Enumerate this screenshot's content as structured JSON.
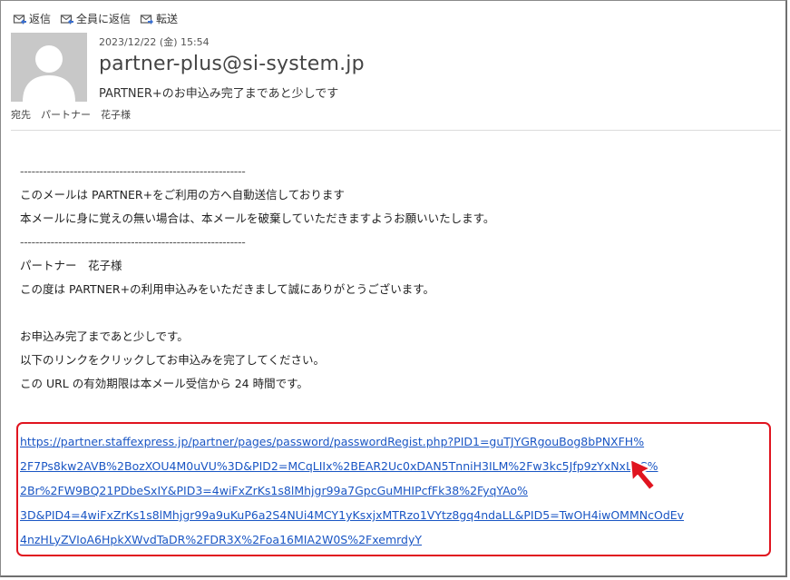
{
  "toolbar": {
    "reply": "返信",
    "reply_all": "全員に返信",
    "forward": "転送"
  },
  "header": {
    "date": "2023/12/22 (金) 15:54",
    "sender": "partner-plus@si-system.jp",
    "subject": "PARTNER+のお申込み完了まであと少しです",
    "to": "宛先　パートナー　花子様"
  },
  "body": {
    "separator": "-----------------------------------------------------------",
    "line1": "このメールは PARTNER+をご利用の方へ自動送信しております",
    "line2": "本メールに身に覚えの無い場合は、本メールを破棄していただきますようお願いいたします。",
    "addressee": "パートナー　花子様",
    "thanks": "この度は PARTNER+の利用申込みをいただきまして誠にありがとうございます。",
    "almost": "お申込み完了まであと少しです。",
    "click": "以下のリンクをクリックしてお申込みを完了してください。",
    "expiry": "この URL の有効期限は本メール受信から 24 時間です。"
  },
  "link": {
    "lines": [
      "https://partner.staffexpress.jp/partner/pages/password/passwordRegist.php?PID1=guTJYGRgouBog8bPNXFH%",
      "2F7Ps8kw2AVB%2BozXOU4M0uVU%3D&PID2=MCqLIIx%2BEAR2Uc0xDAN5TnniH3ILM%2Fw3kc5Jfp9zYxNxL4C%",
      "2Br%2FW9BQ21PDbeSxIY&PID3=4wiFxZrKs1s8lMhjgr99a7GpcGuMHIPcfFk38%2FyqYAo%",
      "3D&PID4=4wiFxZrKs1s8lMhjgr99a9uKuP6a2S4NUi4MCY1yKsxjxMTRzo1VYtz8gq4ndaLL&PID5=TwOH4iwOMMNcOdEv",
      "4nzHLyZVIoA6HpkXWvdTaDR%2FDR3X%2Foa16MIA2W0S%2FxemrdyY"
    ]
  },
  "colors": {
    "link": "#1a56c4",
    "highlight_box": "#e0141f",
    "cursor": "#e0141f"
  }
}
